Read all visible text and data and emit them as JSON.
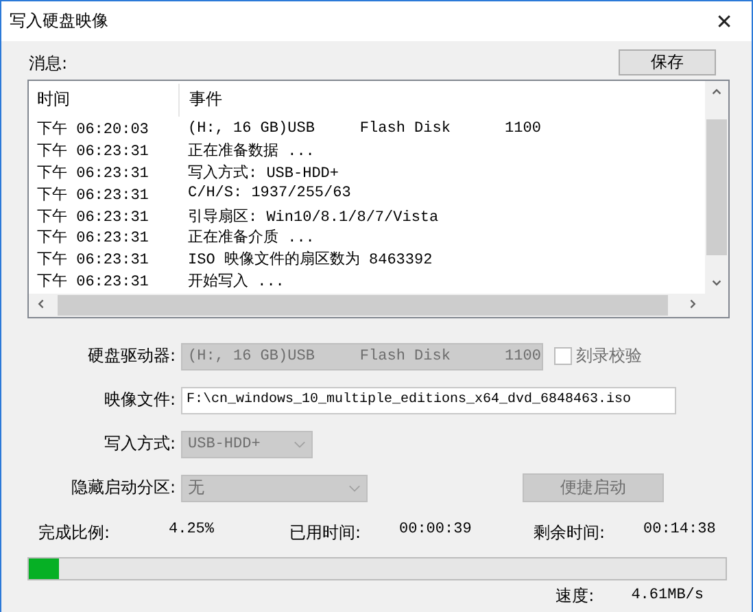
{
  "window": {
    "title": "写入硬盘映像",
    "close": "✕"
  },
  "messages": {
    "label": "消息:",
    "save_button": "保存",
    "columns": [
      "时间",
      "事件"
    ],
    "rows": [
      {
        "time": "下午 06:20:03",
        "event": "(H:, 16 GB)USB     Flash Disk      1100"
      },
      {
        "time": "下午 06:23:31",
        "event": "正在准备数据 ..."
      },
      {
        "time": "下午 06:23:31",
        "event": "写入方式: USB-HDD+"
      },
      {
        "time": "下午 06:23:31",
        "event": "C/H/S: 1937/255/63"
      },
      {
        "time": "下午 06:23:31",
        "event": "引导扇区: Win10/8.1/8/7/Vista"
      },
      {
        "time": "下午 06:23:31",
        "event": "正在准备介质 ..."
      },
      {
        "time": "下午 06:23:31",
        "event": "ISO 映像文件的扇区数为 8463392"
      },
      {
        "time": "下午 06:23:31",
        "event": "开始写入 ..."
      }
    ]
  },
  "form": {
    "drive": {
      "label": "硬盘驱动器:",
      "value": "(H:, 16 GB)USB     Flash Disk      1100",
      "disabled": true
    },
    "verify": {
      "label": "刻录校验",
      "checked": false,
      "disabled": true
    },
    "image_file": {
      "label": "映像文件:",
      "value": "F:\\cn_windows_10_multiple_editions_x64_dvd_6848463.iso"
    },
    "write_method": {
      "label": "写入方式:",
      "value": "USB-HDD+",
      "disabled": true
    },
    "hidden_partition": {
      "label": "隐藏启动分区:",
      "value": "无",
      "disabled": true
    },
    "quick_boot_button": {
      "label": "便捷启动",
      "disabled": true
    }
  },
  "progress": {
    "percent_label": "完成比例:",
    "percent": "4.25%",
    "elapsed_label": "已用时间:",
    "elapsed": "00:00:39",
    "remaining_label": "剩余时间:",
    "remaining": "00:14:38",
    "level": 0.0425,
    "speed_label": "速度:",
    "speed": "4.61MB/s"
  }
}
